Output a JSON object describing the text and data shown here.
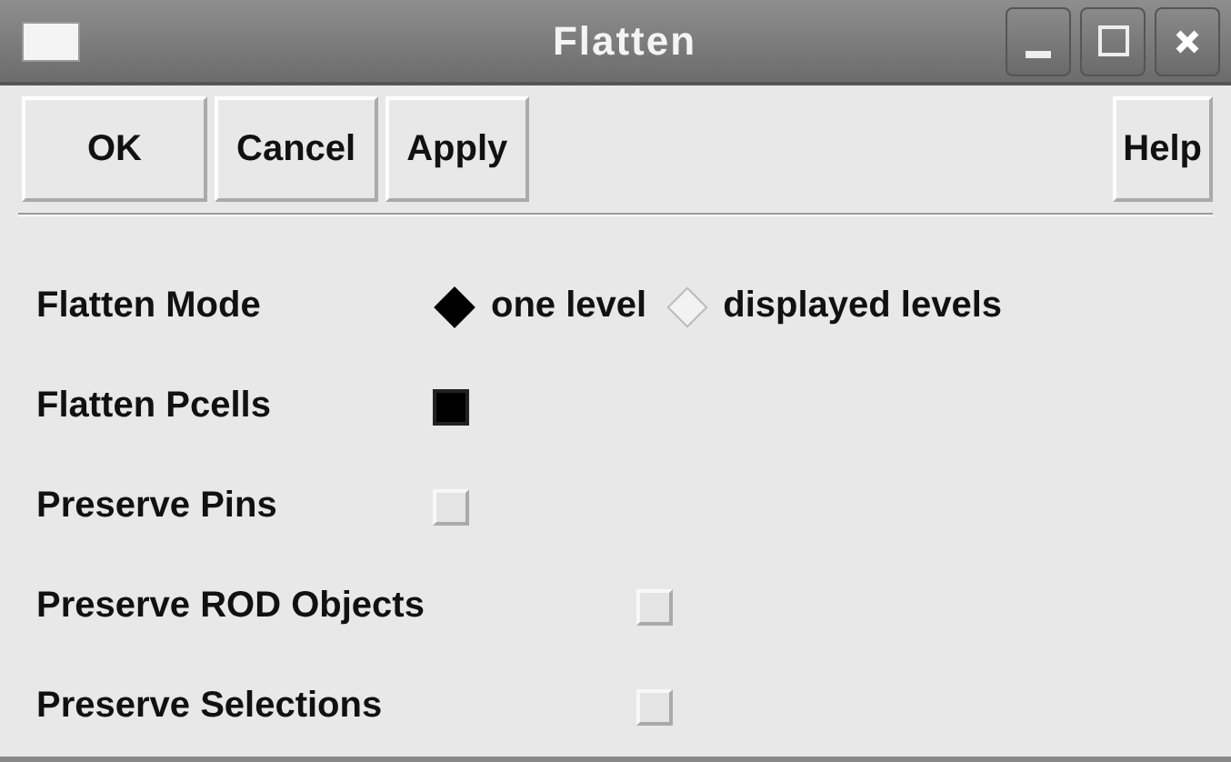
{
  "window": {
    "title": "Flatten"
  },
  "buttons": [
    {
      "label": "OK"
    },
    {
      "label": "Cancel"
    },
    {
      "label": "Apply"
    },
    {
      "label": "Help"
    }
  ],
  "options": [
    {
      "kind": "radio",
      "label": "Flatten Mode",
      "choices": [
        {
          "label": "one level",
          "selected": true
        },
        {
          "label": "displayed levels",
          "selected": false
        }
      ]
    },
    {
      "kind": "checkbox",
      "label": "Flatten Pcells",
      "checked": true
    },
    {
      "kind": "checkbox",
      "label": "Preserve Pins",
      "checked": false
    },
    {
      "kind": "checkbox",
      "label": "Preserve ROD Objects",
      "checked": false
    },
    {
      "kind": "checkbox",
      "label": "Preserve Selections",
      "checked": false
    }
  ]
}
